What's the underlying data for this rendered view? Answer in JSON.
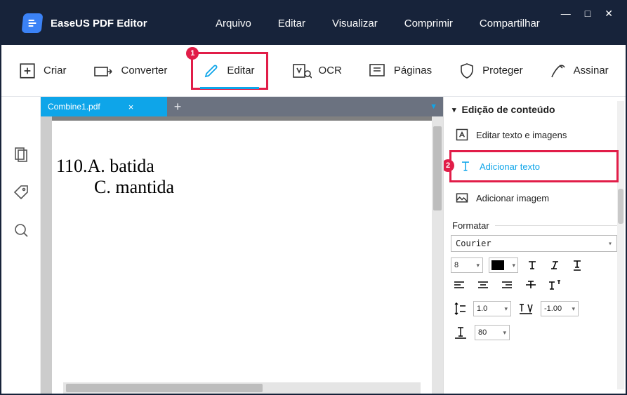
{
  "app": {
    "title": "EaseUS PDF Editor"
  },
  "menubar": [
    "Arquivo",
    "Editar",
    "Visualizar",
    "Comprimir",
    "Compartilhar"
  ],
  "toolbar": {
    "criar": "Criar",
    "converter": "Converter",
    "editar": "Editar",
    "ocr": "OCR",
    "paginas": "Páginas",
    "proteger": "Proteger",
    "assinar": "Assinar"
  },
  "annotations": {
    "badge1": "1",
    "badge2": "2"
  },
  "tab": {
    "filename": "Combine1.pdf"
  },
  "document": {
    "line1": "110.A. batida",
    "line2": "C.  mantida"
  },
  "panel": {
    "header": "Edição de conteúdo",
    "edit_text_images": "Editar texto e imagens",
    "add_text": "Adicionar texto",
    "add_image": "Adicionar imagem",
    "format_label": "Formatar",
    "font": "Courier",
    "font_size": "8",
    "line_height": "1.0",
    "char_spacing": "-1.00",
    "indent": "80"
  }
}
